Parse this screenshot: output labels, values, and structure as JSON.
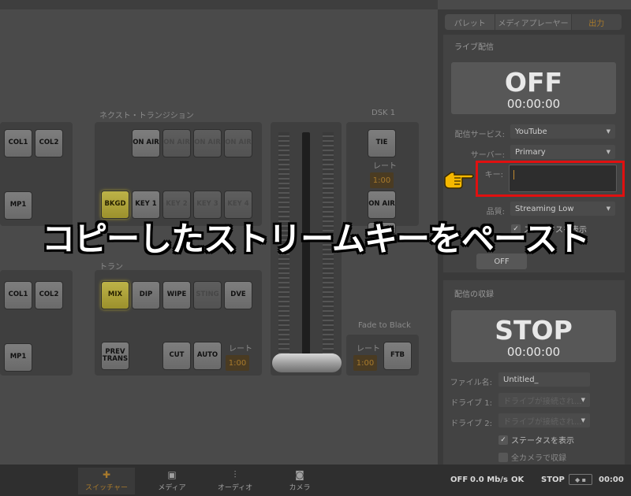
{
  "overlay": {
    "caption": "コピーしたストリームキーをペースト"
  },
  "switcher": {
    "next_transition_label": "ネクスト・トランジション",
    "transition_label": "トラン",
    "dsk_label": "DSK 1",
    "fade_label": "Fade to Black",
    "rate_label": "レート",
    "left_top": [
      "COL1",
      "COL2"
    ],
    "left_mid": "MP1",
    "left_bot": [
      "COL1",
      "COL2"
    ],
    "left_bottom_mp": "MP1",
    "on_air_row": [
      "ON AIR",
      "ON AIR",
      "ON AIR",
      "ON AIR"
    ],
    "keys": [
      "BKGD",
      "KEY 1",
      "KEY 2",
      "KEY 3",
      "KEY 4"
    ],
    "styles": [
      "MIX",
      "DIP",
      "WIPE",
      "STING",
      "DVE"
    ],
    "prev_trans": "PREV TRANS",
    "cut": "CUT",
    "auto": "AUTO",
    "auto_rate": "1:00",
    "dsk_tie": "TIE",
    "dsk_rate": "1:00",
    "dsk_onair": "ON AIR",
    "ftb": "FTB",
    "ftb_rate": "1:00"
  },
  "tabs": [
    "パレット",
    "メディアプレーヤー",
    "出力"
  ],
  "live": {
    "title": "ライブ配信",
    "status": "OFF",
    "timer": "00:00:00",
    "service_label": "配信サービス:",
    "service_value": "YouTube",
    "server_label": "サーバー:",
    "server_value": "Primary",
    "key_label": "キー:",
    "key_value": "",
    "quality_label": "品質:",
    "quality_value": "Streaming Low",
    "show_status": "ステータスを表示",
    "on_air_button": "ON AIR",
    "off_button": "OFF"
  },
  "record": {
    "title": "配信の収録",
    "status": "STOP",
    "timer": "00:00:00",
    "filename_label": "ファイル名:",
    "filename_value": "Untitled_",
    "drive1_label": "ドライブ 1:",
    "drive1_value": "ドライブが接続され...",
    "drive2_label": "ドライブ 2:",
    "drive2_value": "ドライブが接続され...",
    "show_status": "ステータスを表示",
    "all_cameras": "全カメラで収録"
  },
  "bottom_tabs": [
    "スイッチャー",
    "メディア",
    "オーディオ",
    "カメラ"
  ],
  "status_bar": {
    "stream_state": "OFF",
    "bitrate": "0.0 Mb/s",
    "ok": "OK",
    "record_state": "STOP",
    "time": "00:00"
  },
  "colors": {
    "accent": "#a87a2c",
    "highlight_border": "#e01010",
    "pointer": "#f6b800"
  }
}
